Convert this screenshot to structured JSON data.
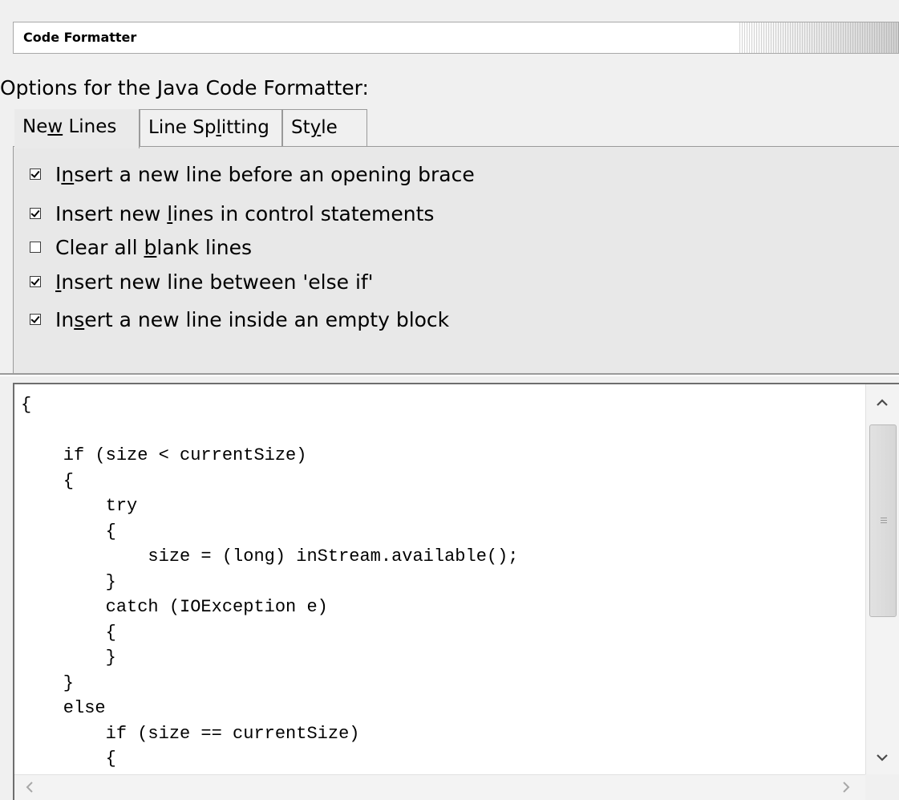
{
  "header": {
    "title": "Code Formatter"
  },
  "options_label": "Options for the Java Code Formatter:",
  "tabs": [
    {
      "pre": "Ne",
      "mnemonic": "w",
      "post": " Lines",
      "active": true
    },
    {
      "pre": "Line Sp",
      "mnemonic": "l",
      "post": "itting",
      "active": false
    },
    {
      "pre": "St",
      "mnemonic": "y",
      "post": "le",
      "active": false
    }
  ],
  "options": [
    {
      "pre": "I",
      "mnemonic": "n",
      "post": "sert a new line before an opening brace",
      "checked": true
    },
    {
      "pre": "Insert new ",
      "mnemonic": "l",
      "post": "ines in control statements",
      "checked": true
    },
    {
      "pre": "Clear all ",
      "mnemonic": "b",
      "post": "lank lines",
      "checked": false
    },
    {
      "pre": "",
      "mnemonic": "I",
      "post": "nsert new line between 'else if'",
      "checked": true
    },
    {
      "pre": "In",
      "mnemonic": "s",
      "post": "ert a new line inside an empty block",
      "checked": true
    }
  ],
  "code_preview": "{\n\n    if (size < currentSize)\n    {\n        try\n        {\n            size = (long) inStream.available();\n        }\n        catch (IOException e)\n        {\n        }\n    }\n    else\n        if (size == currentSize)\n        {",
  "icons": {
    "scroll_up": "chevron-up-icon",
    "scroll_down": "chevron-down-icon",
    "scroll_left": "chevron-left-icon",
    "scroll_right": "chevron-right-icon"
  }
}
